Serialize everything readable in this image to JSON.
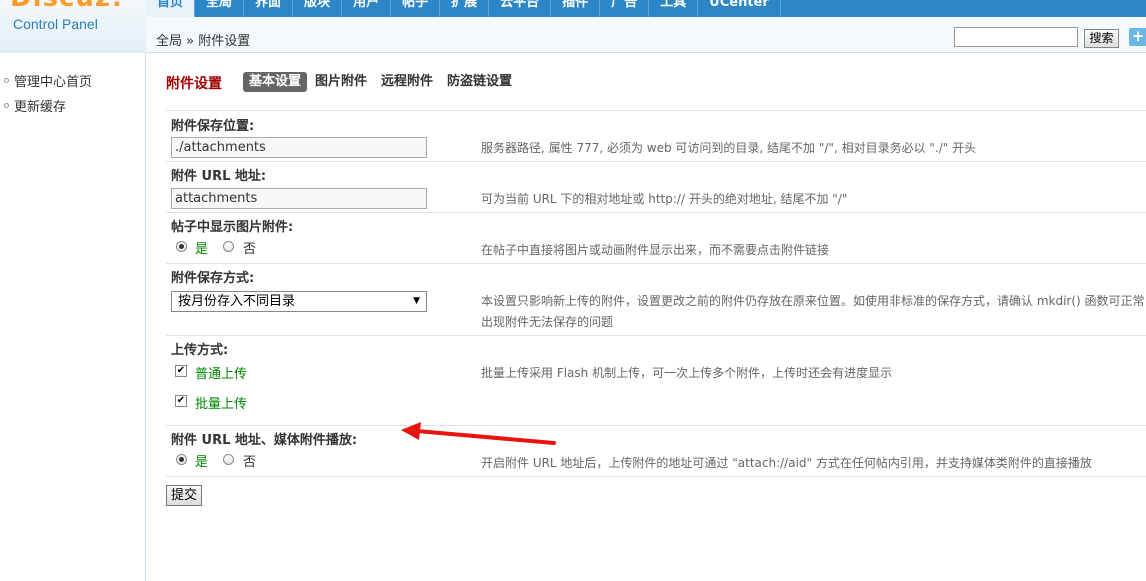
{
  "header": {
    "brand": "Discuz!",
    "brand_sub": "Control Panel",
    "nav": [
      "首页",
      "全局",
      "界面",
      "版块",
      "用户",
      "帖子",
      "扩展",
      "云平台",
      "插件",
      "广告",
      "工具",
      "UCenter"
    ],
    "breadcrumb": "全局 » 附件设置",
    "search_value": "",
    "search_button": "搜索",
    "add_glyph": "+"
  },
  "sidebar": {
    "items": [
      "管理中心首页",
      "更新缓存"
    ]
  },
  "main": {
    "title": "附件设置",
    "tabs": [
      "基本设置",
      "图片附件",
      "远程附件",
      "防盗链设置"
    ],
    "fields": {
      "save_path": {
        "label": "附件保存位置:",
        "value": "./attachments",
        "help": "服务器路径, 属性 777, 必须为 web 可访问到的目录, 结尾不加 \"/\", 相对目录务必以 \"./\" 开头"
      },
      "url": {
        "label": "附件 URL 地址:",
        "value": "attachments",
        "help": "可为当前 URL 下的相对地址或 http:// 开头的绝对地址, 结尾不加 \"/\""
      },
      "show_images": {
        "label": "帖子中显示图片附件:",
        "yes": "是",
        "no": "否",
        "selected": "是",
        "help": "在帖子中直接将图片或动画附件显示出来，而不需要点击附件链接"
      },
      "save_mode": {
        "label": "附件保存方式:",
        "value": "按月份存入不同目录",
        "help_line1": "本设置只影响新上传的附件，设置更改之前的附件仍存放在原来位置。如使用非标准的保存方式，请确认 mkdir() 函数可正常",
        "help_line2": "出现附件无法保存的问题"
      },
      "upload_mode": {
        "label": "上传方式:",
        "option1": "普通上传",
        "option2": "批量上传",
        "check_glyph": "✔",
        "help": "批量上传采用 Flash 机制上传，可一次上传多个附件，上传时还会有进度显示"
      },
      "media": {
        "label": "附件 URL 地址、媒体附件播放:",
        "yes": "是",
        "no": "否",
        "selected": "是",
        "help": "开启附件 URL 地址后，上传附件的地址可通过 \"attach://aid\" 方式在任何帖内引用，并支持媒体类附件的直接播放"
      }
    },
    "submit_label": "提交"
  },
  "colors": {
    "nav_bar": "#2b87c7",
    "title_red": "#a30000",
    "option_green": "#008800",
    "annotation_arrow": "#e8140f"
  }
}
